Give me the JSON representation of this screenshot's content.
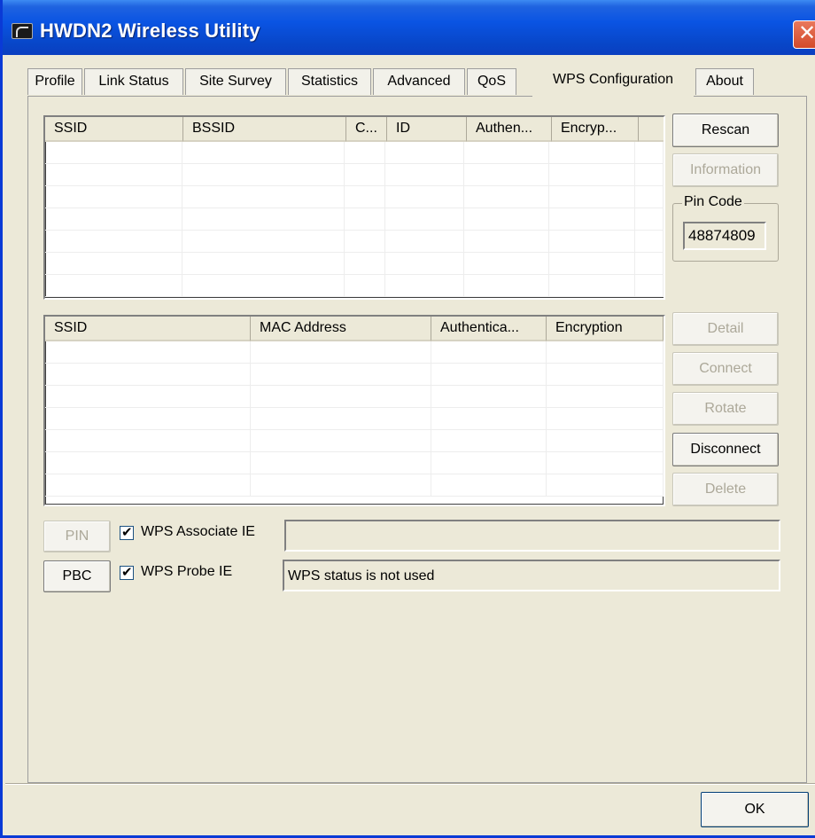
{
  "window": {
    "title": "HWDN2 Wireless Utility",
    "close_glyph": "✕"
  },
  "tabs": [
    {
      "label": "Profile"
    },
    {
      "label": "Link Status"
    },
    {
      "label": "Site Survey"
    },
    {
      "label": "Statistics"
    },
    {
      "label": "Advanced"
    },
    {
      "label": "QoS"
    },
    {
      "label": "WPS Configuration",
      "active": true
    },
    {
      "label": "About"
    }
  ],
  "ap_list": {
    "columns": [
      "SSID",
      "BSSID",
      "C...",
      "ID",
      "Authen...",
      "Encryp...",
      ""
    ],
    "rows": []
  },
  "profile_list": {
    "columns": [
      "SSID",
      "MAC Address",
      "Authentica...",
      "Encryption"
    ],
    "rows": []
  },
  "buttons": {
    "rescan": "Rescan",
    "information": "Information",
    "detail": "Detail",
    "connect": "Connect",
    "rotate": "Rotate",
    "disconnect": "Disconnect",
    "delete": "Delete",
    "pin": "PIN",
    "pbc": "PBC",
    "ok": "OK"
  },
  "pin_code": {
    "label": "Pin Code",
    "value": "48874809"
  },
  "options": {
    "wps_associate_ie": {
      "label": "WPS Associate IE",
      "checked": true,
      "value": ""
    },
    "wps_probe_ie": {
      "label": "WPS Probe IE",
      "checked": true
    },
    "status_text": "WPS status is not used"
  },
  "colors": {
    "titlebar": "#0a54e3",
    "face": "#ece9d8",
    "disabled_text": "#aca899"
  },
  "icons": {
    "app": "wireless-utility-icon",
    "close": "close-icon",
    "check": "checkmark-icon"
  }
}
